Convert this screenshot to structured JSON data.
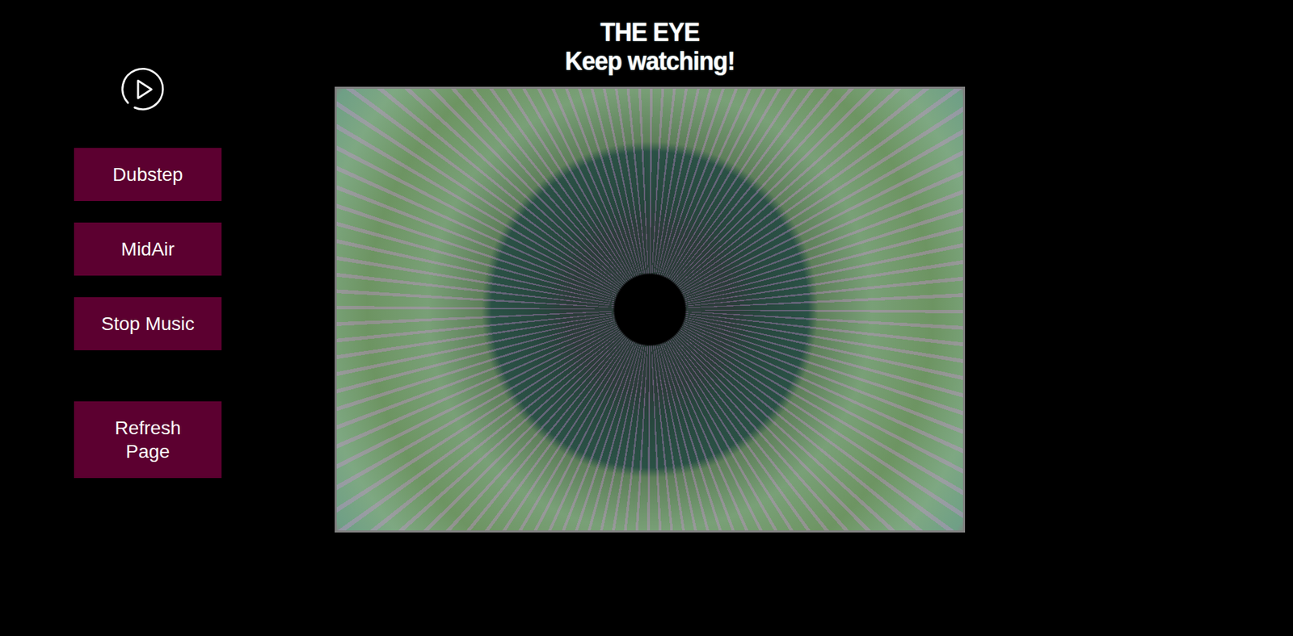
{
  "header": {
    "title": "THE EYE",
    "subtitle": "Keep watching!"
  },
  "buttons": [
    {
      "label": "Dubstep",
      "kind": "music"
    },
    {
      "label": "MidAir",
      "kind": "music"
    },
    {
      "label": "Stop Music",
      "kind": "music"
    },
    {
      "label": "Refresh Page",
      "kind": "page"
    }
  ]
}
